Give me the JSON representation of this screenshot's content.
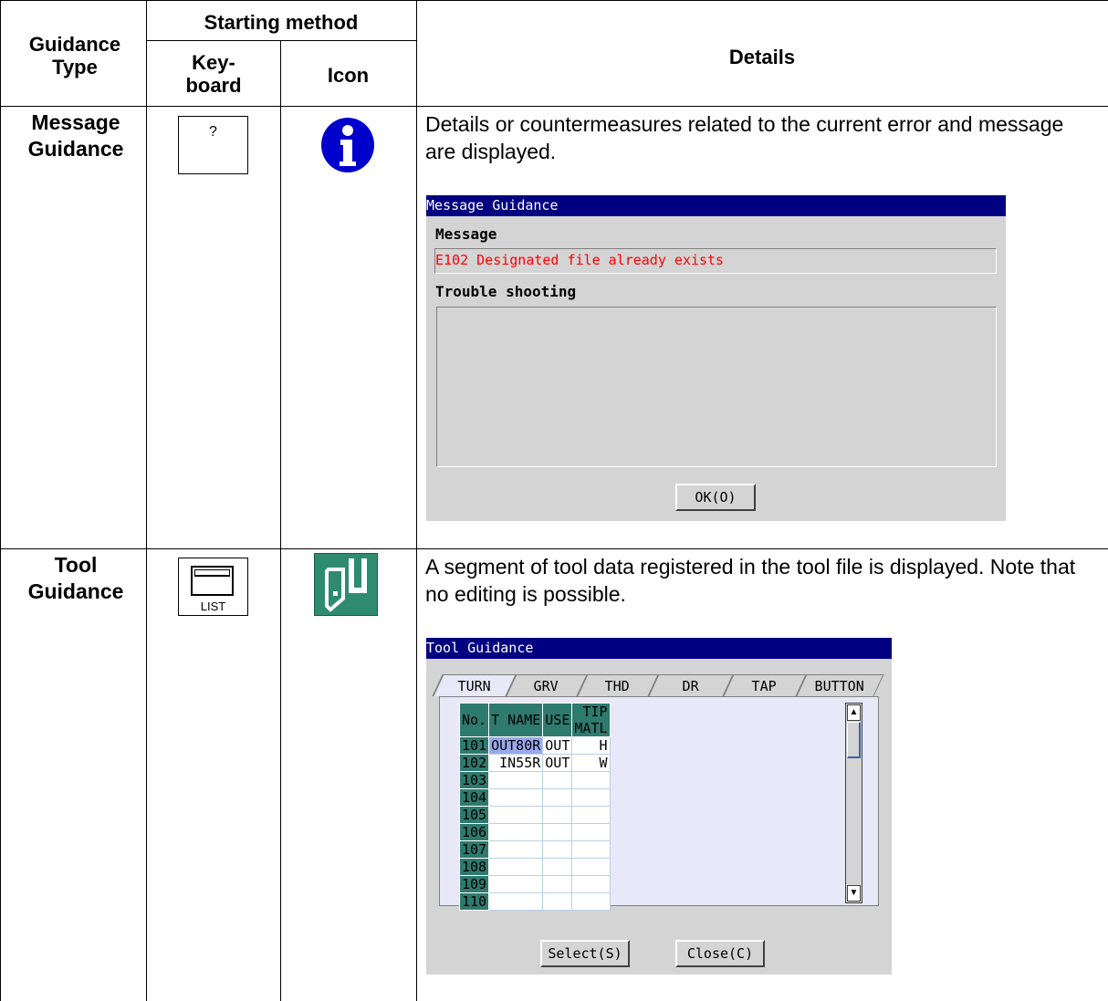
{
  "header": {
    "guidance_type": "Guidance Type",
    "starting_method": "Starting method",
    "keyboard": "Key-board",
    "icon": "Icon",
    "details": "Details"
  },
  "rows": [
    {
      "type": "Message Guidance",
      "key_label": "?",
      "icon": "info-icon",
      "description": "Details or countermeasures related to the current error and message are displayed.",
      "window": {
        "title": "Message Guidance",
        "message_label": "Message",
        "message_value": "E102 Designated file already exists",
        "trouble_label": "Trouble shooting",
        "ok_button": "OK(O)"
      }
    },
    {
      "type": "Tool Guidance",
      "key_label": "LIST",
      "icon": "tool-icon",
      "description": "A segment of tool data registered in the tool file is displayed. Note that no editing is possible.",
      "window": {
        "title": "Tool Guidance",
        "tabs": [
          "TURN",
          "GRV",
          "THD",
          "DR",
          "TAP",
          "BUTTON"
        ],
        "columns": [
          "No.",
          "T NAME",
          "USE",
          "TIP MATL"
        ],
        "table": [
          [
            "101",
            "OUT80R",
            "OUT",
            "H"
          ],
          [
            "102",
            "IN55R",
            "OUT",
            "W"
          ],
          [
            "103",
            "",
            "",
            ""
          ],
          [
            "104",
            "",
            "",
            ""
          ],
          [
            "105",
            "",
            "",
            ""
          ],
          [
            "106",
            "",
            "",
            ""
          ],
          [
            "107",
            "",
            "",
            ""
          ],
          [
            "108",
            "",
            "",
            ""
          ],
          [
            "109",
            "",
            "",
            ""
          ],
          [
            "110",
            "",
            "",
            ""
          ]
        ],
        "select_button": "Select(S)",
        "close_button": "Close(C)"
      }
    }
  ],
  "colors": {
    "titlebar": "#000080",
    "error_text": "#ff0000",
    "table_header": "#2e7a6e",
    "selection": "#9aa8ec",
    "info_icon": "#0000cc",
    "tool_icon": "#2e8b6e"
  }
}
